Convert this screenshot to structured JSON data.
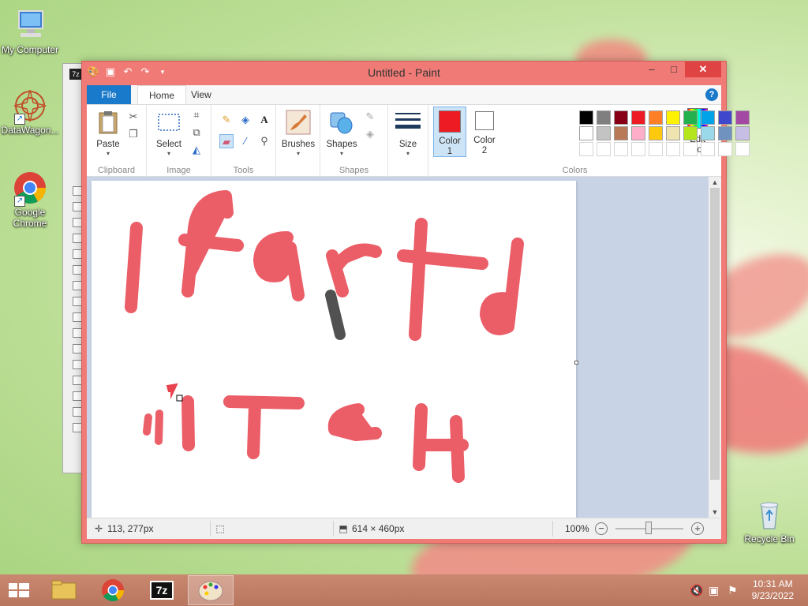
{
  "desktop": {
    "icons": [
      {
        "label": "My Computer"
      },
      {
        "label": "DataWagon..."
      },
      {
        "label": "Google Chrome"
      },
      {
        "label": "Recycle Bin"
      }
    ]
  },
  "window": {
    "title": "Untitled - Paint",
    "tabs": {
      "file": "File",
      "home": "Home",
      "view": "View"
    },
    "help": "?"
  },
  "ribbon": {
    "clipboard": {
      "label": "Clipboard",
      "paste": "Paste"
    },
    "image": {
      "label": "Image",
      "select": "Select"
    },
    "tools": {
      "label": "Tools"
    },
    "brushes": {
      "label": "Brushes"
    },
    "shapes": {
      "label": "Shapes",
      "button": "Shapes"
    },
    "size": {
      "label": "Size"
    },
    "color1": {
      "line1": "Color",
      "line2": "1",
      "value": "#ed1c24"
    },
    "color2": {
      "line1": "Color",
      "line2": "2",
      "value": "#ffffff"
    },
    "colors": {
      "label": "Colors"
    },
    "edit_colors": {
      "line1": "Edit",
      "line2": "colors"
    },
    "palette": [
      "#000000",
      "#7f7f7f",
      "#880015",
      "#ed1c24",
      "#ff7f27",
      "#fff200",
      "#22b14c",
      "#00a2e8",
      "#3f48cc",
      "#a349a4",
      "#ffffff",
      "#c3c3c3",
      "#b97a57",
      "#ffaec9",
      "#ffc90e",
      "#efe4b0",
      "#b5e61d",
      "#99d9ea",
      "#7092be",
      "#c8bfe7"
    ]
  },
  "canvas": {
    "strokes_color": "#e8434e",
    "dark_color": "#333333"
  },
  "status": {
    "cursor_pos": "113, 277px",
    "canvas_size": "614 × 460px",
    "zoom": "100%"
  },
  "taskbar": {
    "time": "10:31 AM",
    "date": "9/23/2022",
    "sevenzip": "7z"
  }
}
